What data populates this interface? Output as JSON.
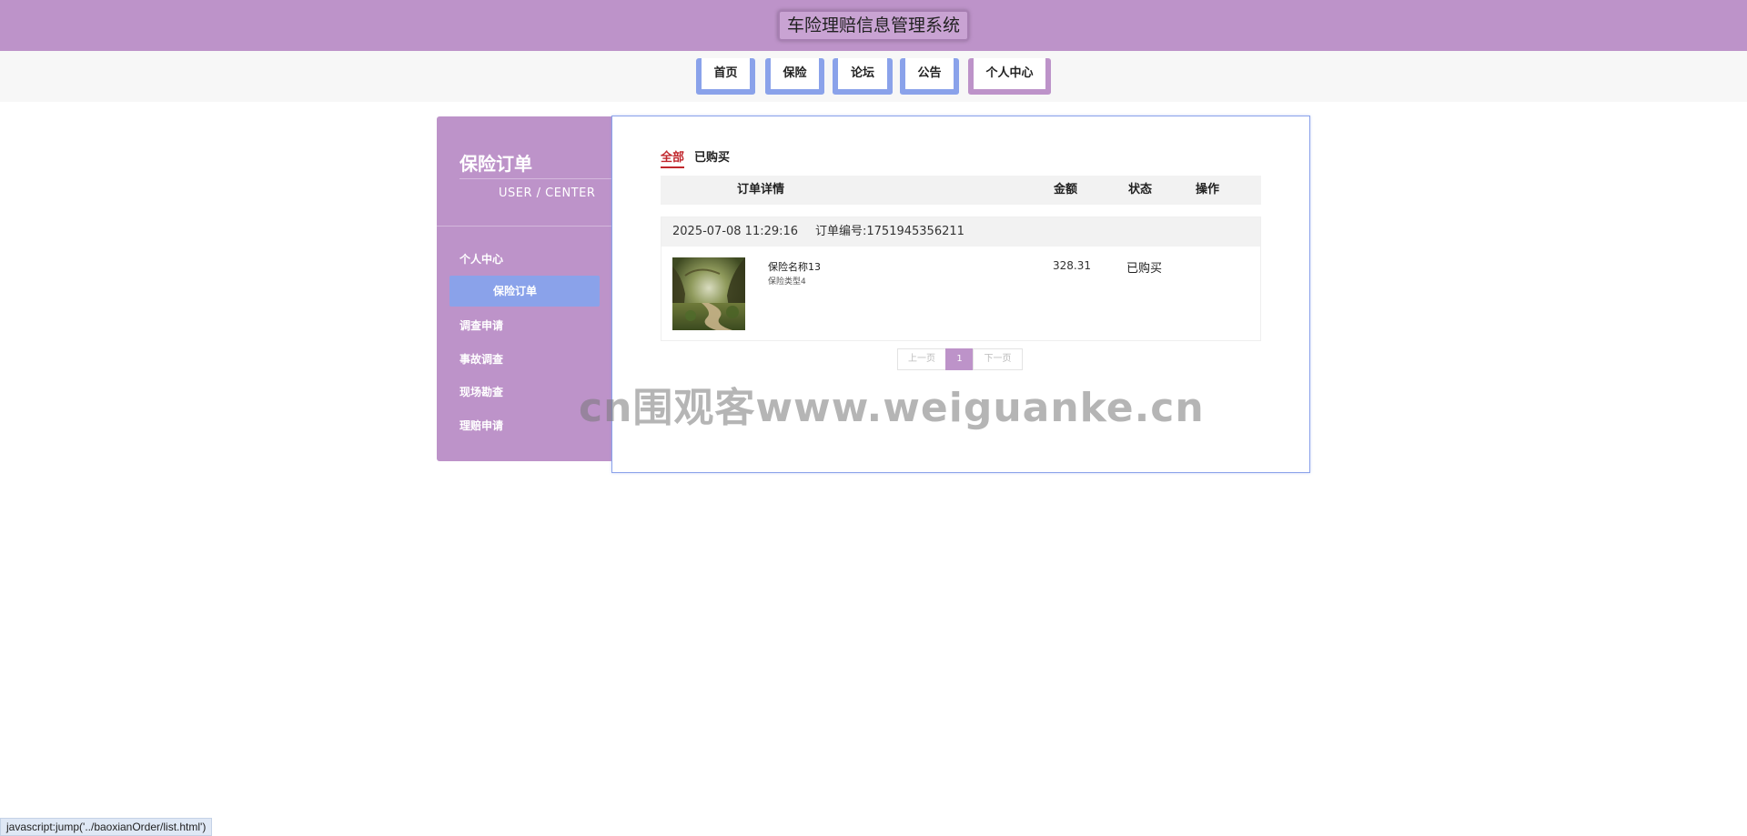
{
  "header": {
    "title": "车险理赔信息管理系统"
  },
  "nav": {
    "items": [
      {
        "label": "首页"
      },
      {
        "label": "保险"
      },
      {
        "label": "论坛"
      },
      {
        "label": "公告"
      },
      {
        "label": "个人中心"
      }
    ],
    "active": "个人中心"
  },
  "sidebar": {
    "title": "保险订单",
    "subtitle": "USER / CENTER",
    "items": [
      {
        "label": "个人中心"
      },
      {
        "label": "保险订单"
      },
      {
        "label": "调查申请"
      },
      {
        "label": "事故调查"
      },
      {
        "label": "现场勘查"
      },
      {
        "label": "理赔申请"
      }
    ],
    "active": "保险订单"
  },
  "tabs": [
    {
      "label": "全部"
    },
    {
      "label": "已购买"
    }
  ],
  "table": {
    "headers": [
      "订单详情",
      "金额",
      "状态",
      "操作"
    ]
  },
  "order": {
    "datetime": "2025-07-08 11:29:16",
    "order_no": "订单编号:1751945356211",
    "name": "保险名称13",
    "type": "保险类型4",
    "amount": "328.31",
    "status": "已购买"
  },
  "pager": {
    "prev": "上一页",
    "current": "1",
    "next": "下一页"
  },
  "watermark": "cn围观客www.weiguanke.cn",
  "statusbar": {
    "url": "javascript:jump('../baoxianOrder/list.html')"
  },
  "colors": {
    "brand_purple": "#bd93c9",
    "accent_blue": "#8aa2ea",
    "active_tab_red": "#c1272d"
  }
}
